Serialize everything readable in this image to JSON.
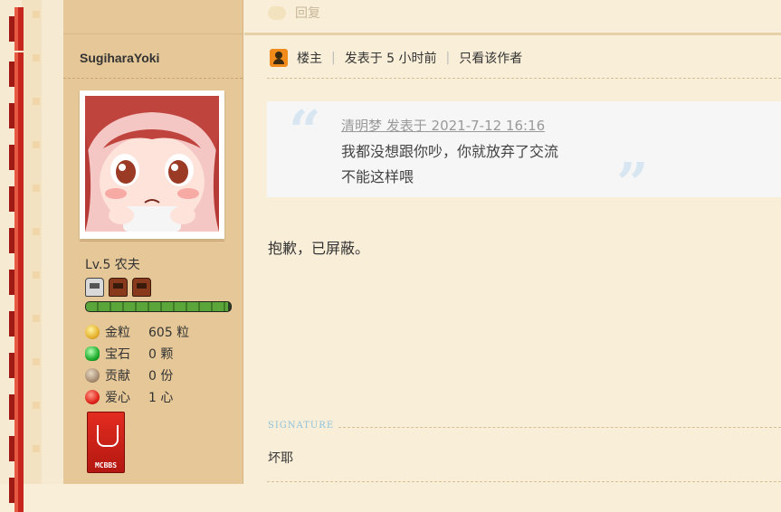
{
  "reply_label": "回复",
  "user": {
    "name": "SugiharaYoki",
    "level": "Lv.5 农夫",
    "xp_fraction": 0.98,
    "stats": [
      {
        "label": "金粒",
        "value": "605 粒",
        "icon": "gold-nugget-icon"
      },
      {
        "label": "宝石",
        "value": "0 颗",
        "icon": "gem-icon"
      },
      {
        "label": "贡献",
        "value": "0 份",
        "icon": "contribution-icon"
      },
      {
        "label": "爱心",
        "value": "1 心",
        "icon": "heart-apple-icon"
      }
    ],
    "medal_text": "MCBBS"
  },
  "post": {
    "floor_label": "楼主",
    "posted_at": "发表于 5 小时前",
    "only_author": "只看该作者",
    "quote": {
      "header": "清明梦 发表于 2021-7-12 16:16",
      "line1": "我都没想跟你吵，你就放弃了交流",
      "line2": "不能这样喂"
    },
    "body": "抱歉，已屏蔽。",
    "signature_label": "SIGNATURE",
    "signature": "坏耶"
  },
  "colors": {
    "brick_red": "#c7261f",
    "user_column": "#e6c898",
    "content_bg": "#f9eed8",
    "quote_mark": "#d8e6f2",
    "signature_label": "#8fc3dc"
  }
}
